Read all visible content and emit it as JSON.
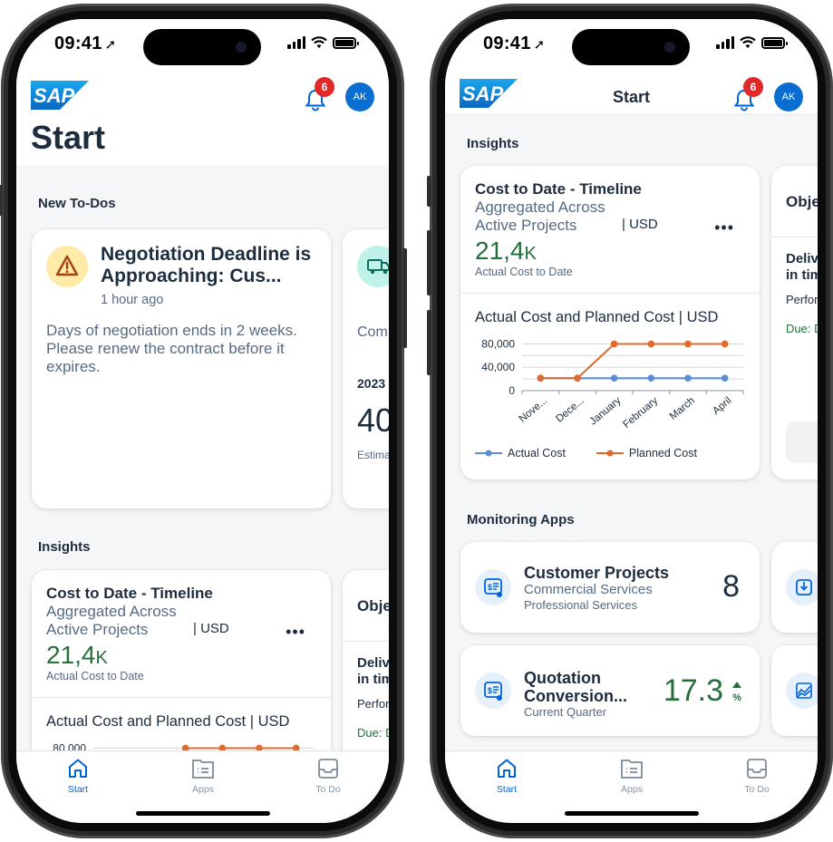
{
  "status_bar": {
    "time": "09:41"
  },
  "header": {
    "logo_text": "SAP",
    "notification_count": "6",
    "avatar_initials": "AK",
    "page_title": "Start"
  },
  "left_screen": {
    "todos_section": "New To-Dos",
    "todo_card": {
      "title": "Negotiation Deadline is Approaching: Cus...",
      "time": "1 hour ago",
      "description": "Days of negotiation ends in 2 weeks. Please renew the contract before it expires."
    },
    "todo_peek": {
      "text": "Com",
      "year": "2023",
      "value": "40",
      "label": "Estima"
    },
    "insights_section": "Insights"
  },
  "right_screen": {
    "insights_section": "Insights",
    "monitoring_section": "Monitoring Apps"
  },
  "insight_card": {
    "title": "Cost to Date - Timeline",
    "subtitle": "Aggregated Across Active Projects",
    "currency": "| USD",
    "more": "•••",
    "kpi_value": "21,4",
    "kpi_scale": "K",
    "kpi_label": "Actual Cost to Date",
    "chart_title": "Actual Cost and Planned Cost | USD"
  },
  "objective_peek": {
    "title": "Obje",
    "subtitle_line1": "Deliv",
    "subtitle_line2": "in tim",
    "perf": "Perfor",
    "due": "Due: D"
  },
  "apps": [
    {
      "title": "Customer Projects",
      "subtitle": "Commercial Services",
      "sub2": "Professional Services",
      "value": "8"
    },
    {
      "title_line1": "Quotation",
      "title_line2": "Conversion...",
      "subtitle": "Current Quarter",
      "value": "17.3",
      "unit": "%"
    }
  ],
  "tabs": [
    {
      "label": "Start",
      "icon": "home-icon"
    },
    {
      "label": "Apps",
      "icon": "apps-icon"
    },
    {
      "label": "To Do",
      "icon": "inbox-icon"
    }
  ],
  "colors": {
    "accent": "#0064d9",
    "kpi_green": "#256f3a",
    "actual": "#5d8dd6",
    "planned": "#e0692c",
    "badge": "#e22929"
  },
  "chart_data": {
    "type": "line",
    "title": "Actual Cost and Planned Cost | USD",
    "categories": [
      "Nove...",
      "Dece...",
      "January",
      "February",
      "March",
      "April"
    ],
    "yticks": [
      0,
      40000,
      80000
    ],
    "ytick_labels": [
      "0",
      "40,000",
      "80,000"
    ],
    "ylim": [
      0,
      100000
    ],
    "grid": true,
    "legend_position": "bottom",
    "series": [
      {
        "name": "Actual Cost",
        "color": "#5d8dd6",
        "values": [
          21400,
          21400,
          21400,
          21400,
          21400,
          21400
        ]
      },
      {
        "name": "Planned Cost",
        "color": "#e0692c",
        "values": [
          21400,
          21400,
          80000,
          80000,
          80000,
          80000
        ]
      }
    ]
  }
}
